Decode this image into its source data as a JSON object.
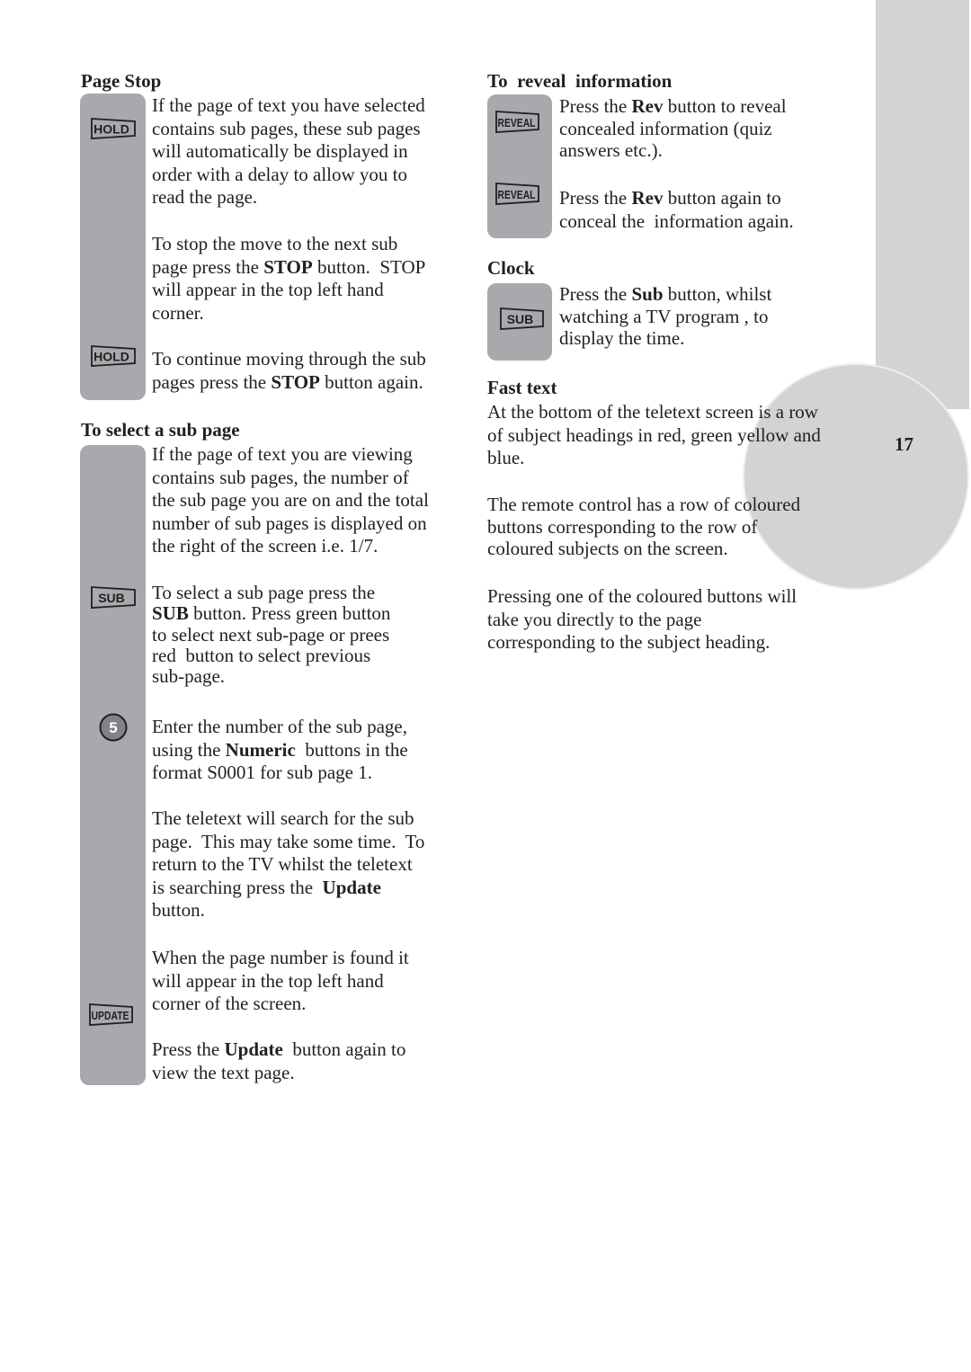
{
  "colors": {
    "icon_bar": "#a7a9ac",
    "page_tab": "#d1d3d4",
    "text": "#231f20"
  },
  "page_number": "17",
  "icons": {
    "hold": "HOLD",
    "sub": "SUB",
    "numeric": "5",
    "update": "UPDATE",
    "reveal": "REVEAL"
  },
  "page_stop": {
    "heading": "Page Stop",
    "p1": [
      "If the page of text you have selected",
      "contains sub pages, these sub pages",
      "will automatically be displayed in",
      "order with a delay to allow you to",
      "read the page."
    ],
    "p2": [
      "To stop the move to the next sub",
      [
        "page press the ",
        "STOP",
        " button.  STOP"
      ],
      "will appear in the top left hand",
      "corner."
    ],
    "p3": [
      "To continue moving through the sub",
      [
        "pages press the ",
        "STOP",
        " button again."
      ]
    ]
  },
  "select_sub_page": {
    "heading": "To select a sub page",
    "p1": [
      "If the page of text you are viewing",
      "contains sub pages, the number of",
      "the sub page you are on and the total",
      "number of sub pages is displayed on",
      "the right of the screen i.e. 1/7."
    ],
    "p2": [
      "To select a sub page press the",
      [
        "SUB",
        " button. Press green button"
      ],
      "to select next sub-page or prees",
      "red  button to select previous",
      "sub-page."
    ],
    "p3": [
      "Enter the number of the sub page,",
      [
        "using the ",
        "Numeric",
        "  buttons in the"
      ],
      "format S0001 for sub page 1."
    ],
    "p4": [
      "The teletext will search for the sub",
      "page.  This may take some time.  To",
      "return to the TV whilst the teletext",
      [
        "is searching press the  ",
        "Update"
      ],
      "button."
    ],
    "p5": [
      "When the page number is found it",
      "will appear in the top left hand",
      "corner of the screen."
    ],
    "p6": [
      [
        "Press the ",
        "Update",
        "  button again to"
      ],
      "view the text page."
    ]
  },
  "reveal": {
    "heading": "To  reveal  information",
    "p1": [
      [
        "Press the ",
        "Rev",
        " button to reveal"
      ],
      "concealed information (quiz",
      "answers etc.)."
    ],
    "p2": [
      [
        "Press the ",
        "Rev",
        " button again to"
      ],
      "conceal the  information again."
    ]
  },
  "clock": {
    "heading": "Clock",
    "p1": [
      [
        "Press the ",
        "Sub",
        " button, whilst"
      ],
      "watching a TV program , to",
      "display the time."
    ]
  },
  "fast_text": {
    "heading": "Fast text",
    "p1": [
      "At the bottom of the teletext screen is a row",
      "of subject headings in red, green yellow and",
      "blue."
    ],
    "p2": [
      "The remote control has a row of coloured",
      "buttons corresponding to the row of",
      "coloured subjects on the screen."
    ],
    "p3": [
      "Pressing one of the coloured buttons will",
      "take you directly to the page",
      "corresponding to the subject heading."
    ]
  }
}
